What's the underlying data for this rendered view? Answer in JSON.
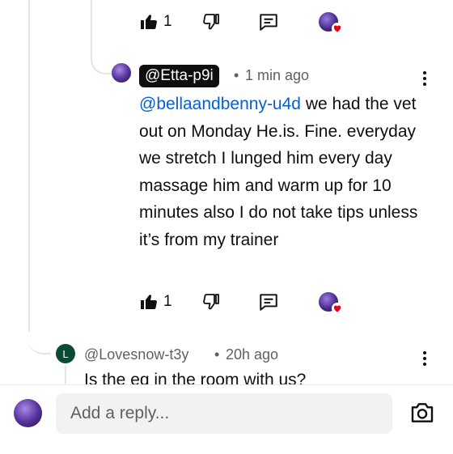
{
  "top_comment_actions": {
    "like_count": "1"
  },
  "reply": {
    "handle": "@Etta-p9i",
    "separator": "•",
    "time": "1 min ago",
    "mention": "@bellaandbenny-u4d",
    "text": " we had the vet out on Monday He.is. Fine. everyday we stretch I lunged him every day massage him and warm up for 10 minutes also I do not take tips unless it’s from my trainer",
    "like_count": "1"
  },
  "next_comment": {
    "avatar_letter": "L",
    "handle": "@Lovesnow-t3y",
    "separator": "•",
    "time": "20h ago",
    "text": "Is the eq in the room with us?"
  },
  "reply_box": {
    "placeholder": "Add a reply..."
  },
  "colors": {
    "mention": "#065fd4",
    "heart": "#e3001b",
    "avatar_green": "#0b4a34"
  },
  "icons": [
    "like-icon",
    "dislike-icon",
    "reply-icon",
    "creator-heart-icon",
    "more-vert-icon",
    "camera-icon"
  ]
}
